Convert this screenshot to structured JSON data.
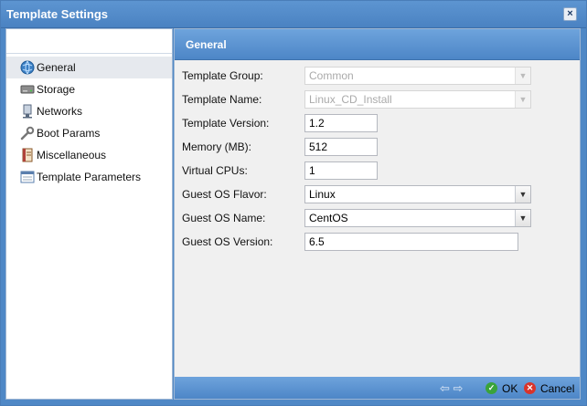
{
  "window": {
    "title": "Template Settings",
    "close_label": "×"
  },
  "nav": {
    "items": [
      {
        "label": "General",
        "icon": "globe-icon"
      },
      {
        "label": "Storage",
        "icon": "hard-drive-icon"
      },
      {
        "label": "Networks",
        "icon": "network-icon"
      },
      {
        "label": "Boot Params",
        "icon": "wrench-icon"
      },
      {
        "label": "Miscellaneous",
        "icon": "notebook-icon"
      },
      {
        "label": "Template Parameters",
        "icon": "parameters-icon"
      }
    ]
  },
  "panel": {
    "title": "General",
    "fields": {
      "template_group": {
        "label": "Template Group:",
        "value": "Common"
      },
      "template_name": {
        "label": "Template Name:",
        "value": "Linux_CD_Install"
      },
      "template_version": {
        "label": "Template Version:",
        "value": "1.2"
      },
      "memory": {
        "label": "Memory (MB):",
        "value": "512"
      },
      "vcpus": {
        "label": "Virtual CPUs:",
        "value": "1"
      },
      "os_flavor": {
        "label": "Guest OS Flavor:",
        "value": "Linux"
      },
      "os_name": {
        "label": "Guest OS Name:",
        "value": "CentOS"
      },
      "os_version": {
        "label": "Guest OS Version:",
        "value": "6.5"
      }
    }
  },
  "footer": {
    "ok_label": "OK",
    "cancel_label": "Cancel"
  }
}
